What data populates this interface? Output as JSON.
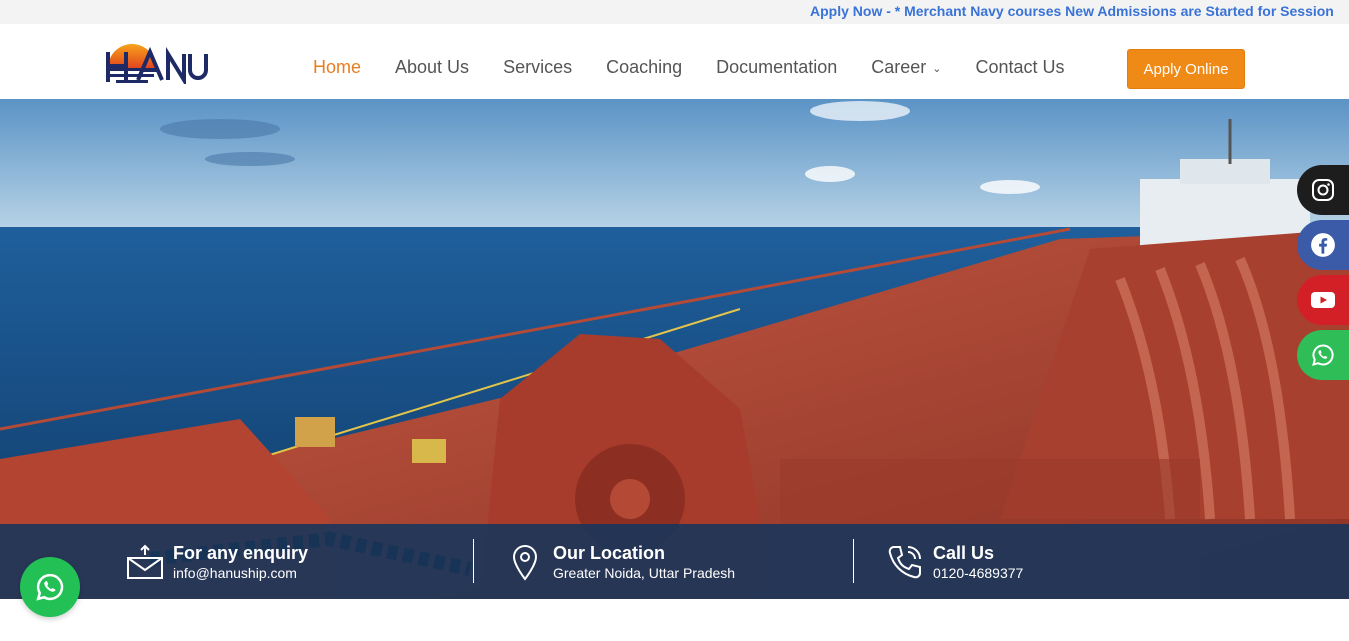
{
  "ticker": {
    "text": "Apply Now - * Merchant Navy courses New Admissions are Started for Session"
  },
  "brand": {
    "logo_name": "hanu-logo",
    "accent": "#f08a16",
    "navy": "#16355c"
  },
  "nav": {
    "items": [
      {
        "label": "Home",
        "active": true
      },
      {
        "label": "About Us"
      },
      {
        "label": "Services"
      },
      {
        "label": "Coaching"
      },
      {
        "label": "Documentation"
      },
      {
        "label": "Career",
        "has_dropdown": true
      },
      {
        "label": "Contact Us"
      }
    ],
    "cta": "Apply Online"
  },
  "social": [
    "instagram-icon",
    "facebook-icon",
    "youtube-icon",
    "whatsapp-icon"
  ],
  "info": {
    "enquiry": {
      "title": "For any enquiry",
      "value": "info@hanuship.com"
    },
    "location": {
      "title": "Our Location",
      "value": "Greater Noida, Uttar Pradesh"
    },
    "call": {
      "title": "Call Us",
      "value": "0120-4689377"
    }
  }
}
